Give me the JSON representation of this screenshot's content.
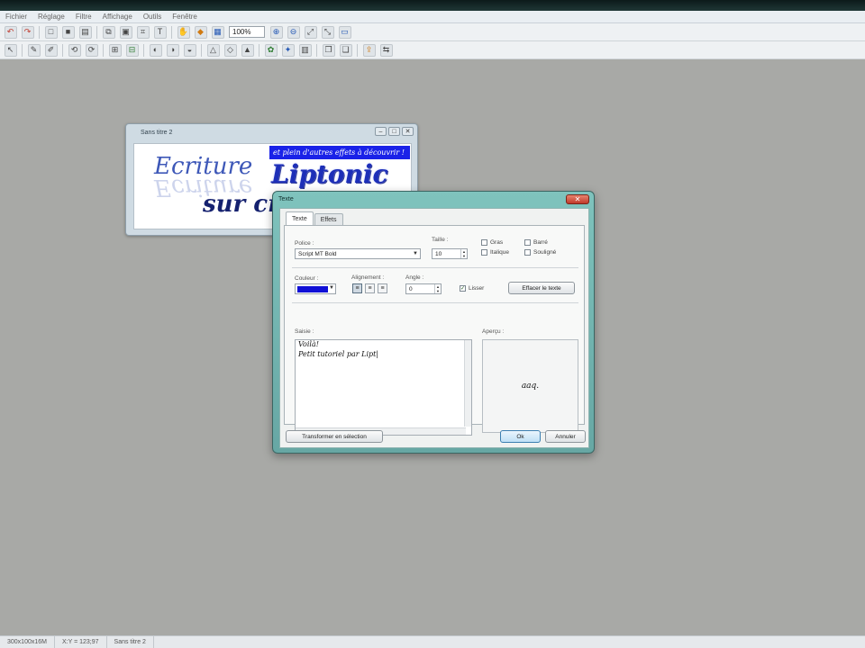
{
  "menu": [
    "Fichier",
    "Réglage",
    "Filtre",
    "Affichage",
    "Outils",
    "Fenêtre"
  ],
  "toolbar": {
    "zoom_value": "100%"
  },
  "status": {
    "dimensions": "300x100x16M",
    "coords": "X:Y = 123;97",
    "doc": "Sans titre 2"
  },
  "document": {
    "title": "Sans titre 2",
    "canvas": {
      "word1": "Ecriture",
      "selection_text": "et plein d'autres effets à découvrir !",
      "liptonic": "Liptonic",
      "word3": "sur cr"
    }
  },
  "dialog": {
    "title": "Texte",
    "close": "✕",
    "tabs": [
      "Texte",
      "Effets"
    ],
    "police_label": "Police :",
    "police_value": "Script MT Bold",
    "taille_label": "Taille :",
    "taille_value": "10",
    "gras": "Gras",
    "italique": "Italique",
    "barre": "Barré",
    "souligne": "Souligné",
    "couleur_label": "Couleur :",
    "alignement_label": "Alignement :",
    "angle_label": "Angle :",
    "angle_value": "0",
    "lisser": "Lisser",
    "effacer": "Effacer le texte",
    "saisie_label": "Saisie :",
    "saisie_lines": [
      "Voilà!",
      "Petit tutoriel par Lipt|"
    ],
    "apercu_label": "Aperçu :",
    "apercu_text": "aaq.",
    "transformer": "Transformer en sélection",
    "ok": "Ok",
    "annuler": "Annuler"
  }
}
